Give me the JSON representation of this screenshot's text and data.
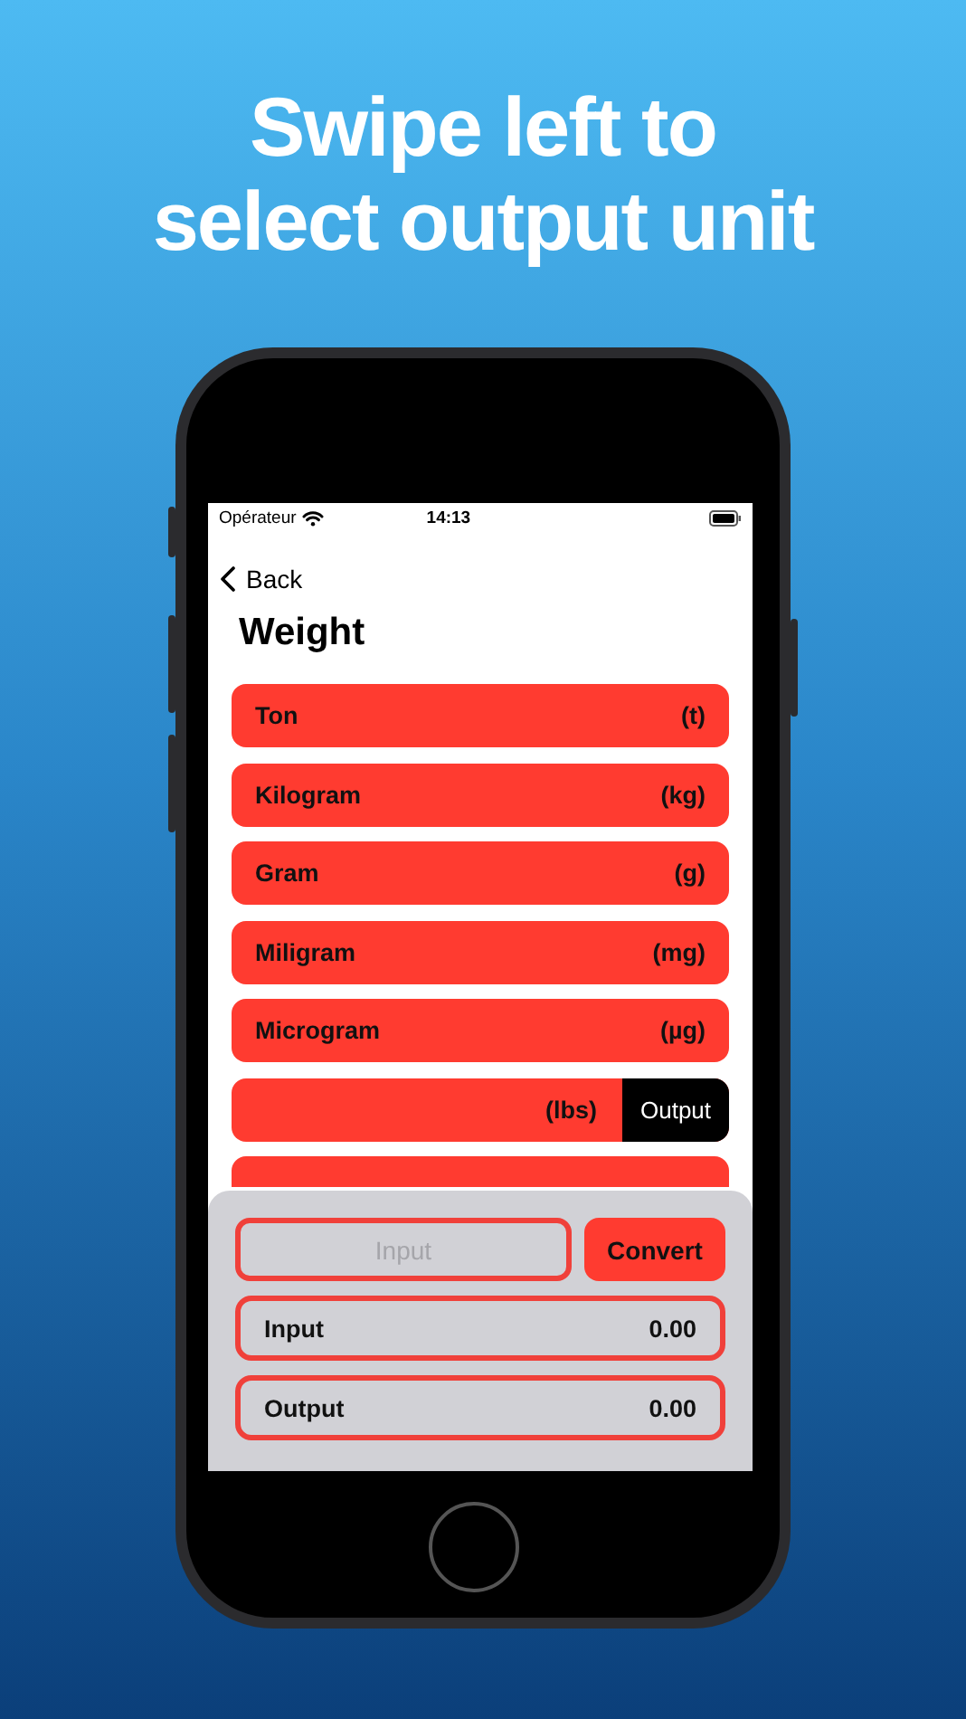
{
  "headline": [
    "Swipe left to",
    "select output unit"
  ],
  "status_bar": {
    "carrier": "Opérateur",
    "time": "14:13"
  },
  "nav": {
    "back": "Back",
    "title": "Weight"
  },
  "units": [
    {
      "name": "Ton",
      "unit": "(t)",
      "swiped": false
    },
    {
      "name": "Kilogram",
      "unit": "(kg)",
      "swiped": false
    },
    {
      "name": "Gram",
      "unit": "(g)",
      "swiped": false
    },
    {
      "name": "Miligram",
      "unit": "(mg)",
      "swiped": false
    },
    {
      "name": "Microgram",
      "unit": "(µg)",
      "swiped": false
    },
    {
      "unit": "(lbs)",
      "swiped": true,
      "action": "Output"
    },
    {
      "swiped": false
    }
  ],
  "panel": {
    "input_placeholder": "Input",
    "convert_button": "Convert",
    "results": [
      {
        "label": "Input",
        "value": "0.00"
      },
      {
        "label": "Output",
        "value": "0.00"
      }
    ]
  }
}
